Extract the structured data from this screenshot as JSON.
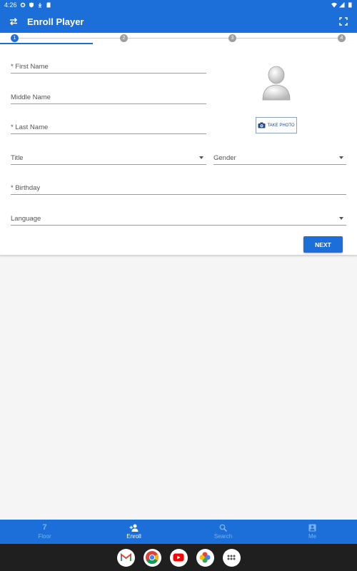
{
  "status_bar": {
    "time": "4:26"
  },
  "app_bar": {
    "title": "Enroll Player",
    "swap_icon": "swap-icon",
    "fullscreen_icon": "fullscreen-icon"
  },
  "stepper": {
    "steps": [
      "1",
      "2",
      "3",
      "4"
    ],
    "active_step": 1
  },
  "form": {
    "first_name_label": "* First Name",
    "middle_name_label": "Middle Name",
    "last_name_label": "* Last Name",
    "title_label": "Title",
    "gender_label": "Gender",
    "birthday_label": "* Birthday",
    "language_label": "Language",
    "take_photo_label": "TAKE PHOTO",
    "next_label": "NEXT"
  },
  "bottom_nav": {
    "items": [
      {
        "label": "Floor",
        "icon": "seven-icon"
      },
      {
        "label": "Enroll",
        "icon": "add-person-icon"
      },
      {
        "label": "Search",
        "icon": "search-icon"
      },
      {
        "label": "Me",
        "icon": "account-box-icon"
      }
    ],
    "active": "Enroll"
  },
  "dock": {
    "apps": [
      "gmail-icon",
      "chrome-icon",
      "youtube-icon",
      "photos-icon",
      "app-drawer-icon"
    ]
  },
  "colors": {
    "primary": "#1c6fd8",
    "nav_inactive": "#7fb0ec",
    "dock_bg": "#1f1f1f"
  }
}
